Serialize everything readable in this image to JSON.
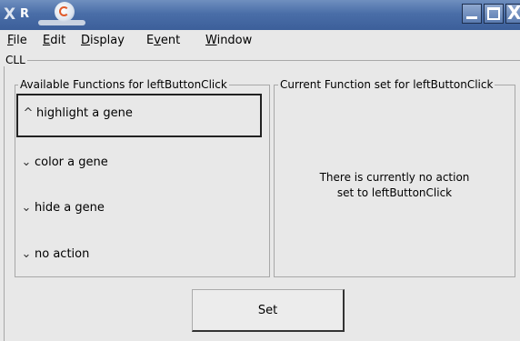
{
  "window": {
    "title_logo": "R",
    "x_glyph": "X",
    "minimize_glyph": "_",
    "maximize_glyph": "□",
    "close_glyph": "X"
  },
  "menu": [
    {
      "label": "File",
      "mnemonic": "F"
    },
    {
      "label": "Edit",
      "mnemonic": "E"
    },
    {
      "label": "Display",
      "mnemonic": "D"
    },
    {
      "label": "Event",
      "mnemonic": "v"
    },
    {
      "label": "Window",
      "mnemonic": "W"
    }
  ],
  "cll_label": "CLL",
  "available_panel": {
    "title": "Available Functions for leftButtonClick",
    "options": [
      {
        "label": "highlight a gene",
        "selected": true
      },
      {
        "label": "color a gene",
        "selected": false
      },
      {
        "label": "hide a gene",
        "selected": false
      },
      {
        "label": "no action",
        "selected": false
      }
    ]
  },
  "current_panel": {
    "title": "Current Function set for leftButtonClick",
    "message_line1": "There is currently no action",
    "message_line2": "set to leftButtonClick"
  },
  "set_button": "Set",
  "icons": {
    "selected_option": "caret-up-icon",
    "unselected_option": "caret-down-icon"
  }
}
